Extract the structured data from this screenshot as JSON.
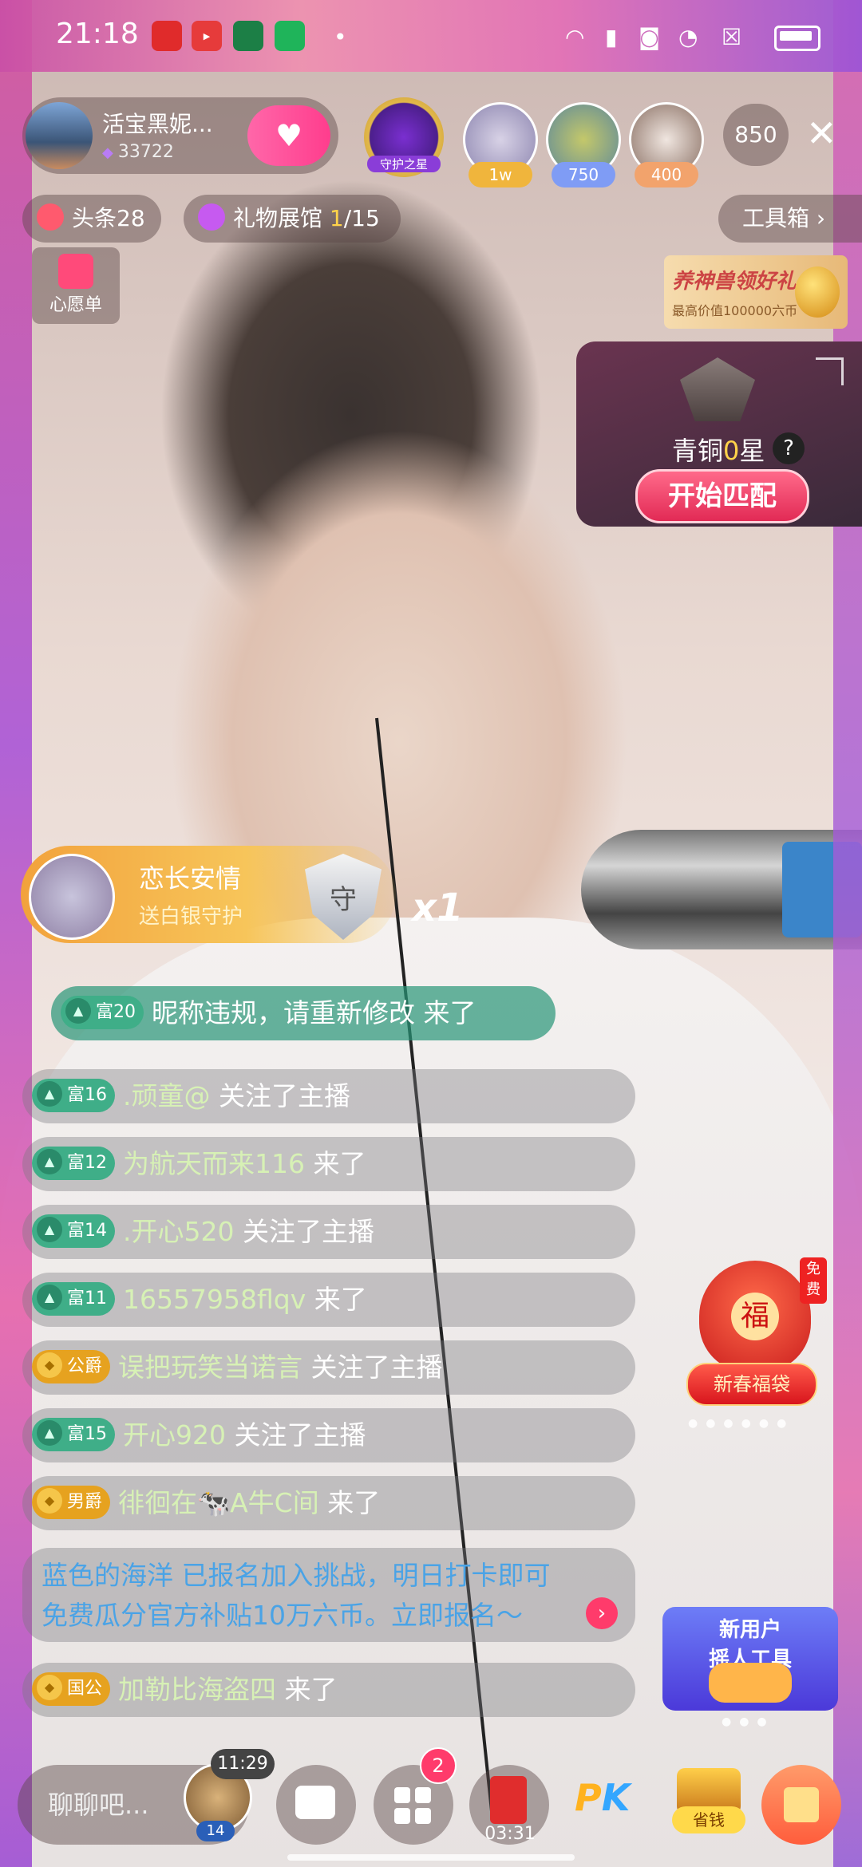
{
  "status_bar": {
    "time": "21:18"
  },
  "header": {
    "anchor_name": "活宝黑妮...",
    "anchor_fans": "33722",
    "guard_star_label": "守护之星",
    "viewers": [
      {
        "tag": "1w",
        "color": "#f0b53c"
      },
      {
        "tag": "750",
        "color": "#7f9cf5"
      },
      {
        "tag": "400",
        "color": "#f2a36c"
      }
    ],
    "viewer_count": "850",
    "headline_chip": "头条28",
    "gallery_chip_prefix": "礼物展馆 ",
    "gallery_current": "1",
    "gallery_total": "/15",
    "toolbox_label": "工具箱 ›",
    "wishlist_label": "心愿单"
  },
  "promo": {
    "title": "养神兽领好礼",
    "subtitle": "最高价值100000六币"
  },
  "pk_card": {
    "rank_prefix": "青铜",
    "rank_value": "0",
    "rank_suffix": "星",
    "match_button": "开始匹配"
  },
  "gift_banner": {
    "user": "恋长安情",
    "action": "送白银守护",
    "shield_char": "守",
    "multiplier": "x1"
  },
  "chat": [
    {
      "level": "富20",
      "level_type": "green",
      "user": "昵称违规，请重新修改",
      "action": " 来了",
      "highlight": true
    },
    {
      "level": "富16",
      "level_type": "green",
      "user": ".顽童@",
      "action": " 关注了主播"
    },
    {
      "level": "富12",
      "level_type": "green",
      "user": "为航天而来116",
      "action": " 来了"
    },
    {
      "level": "富14",
      "level_type": "green",
      "user": ".开心520",
      "action": " 关注了主播"
    },
    {
      "level": "富11",
      "level_type": "green",
      "user": "16557958flqv",
      "action": " 来了"
    },
    {
      "level": "公爵",
      "level_type": "gold",
      "user": "误把玩笑当诺言",
      "action": " 关注了主播"
    },
    {
      "level": "富15",
      "level_type": "green",
      "user": "开心920",
      "action": " 关注了主播"
    },
    {
      "level": "男爵",
      "level_type": "gold",
      "user": "徘徊在🐄A牛C间",
      "action": " 来了"
    },
    {
      "level": "国公",
      "level_type": "gold",
      "user": "加勒比海盗四",
      "action": " 来了"
    }
  ],
  "notice": {
    "line1": "蓝色的海洋 已报名加入挑战，明日打卡即可",
    "line2": "免费瓜分官方补贴10万六币。立即报名～",
    "arrow": "›"
  },
  "lucky_bag": {
    "char": "福",
    "free": "免费",
    "label": "新春福袋"
  },
  "tool_card": {
    "line1": "新用户",
    "line2": "摇人工具"
  },
  "bottom_bar": {
    "chat_placeholder": "聊聊吧...",
    "avatar_timer": "11:29",
    "avatar_level": "14",
    "notif_count": "2",
    "redpacket_timer": "03:31",
    "pk_label_p": "P",
    "pk_label_k": "K",
    "save_label": "省钱"
  },
  "colors": {
    "accent_pink": "#ff3d8d",
    "chat_green": "#3fae88",
    "noble_gold": "#e6a21f",
    "notice_blue": "#4aa3e6"
  }
}
